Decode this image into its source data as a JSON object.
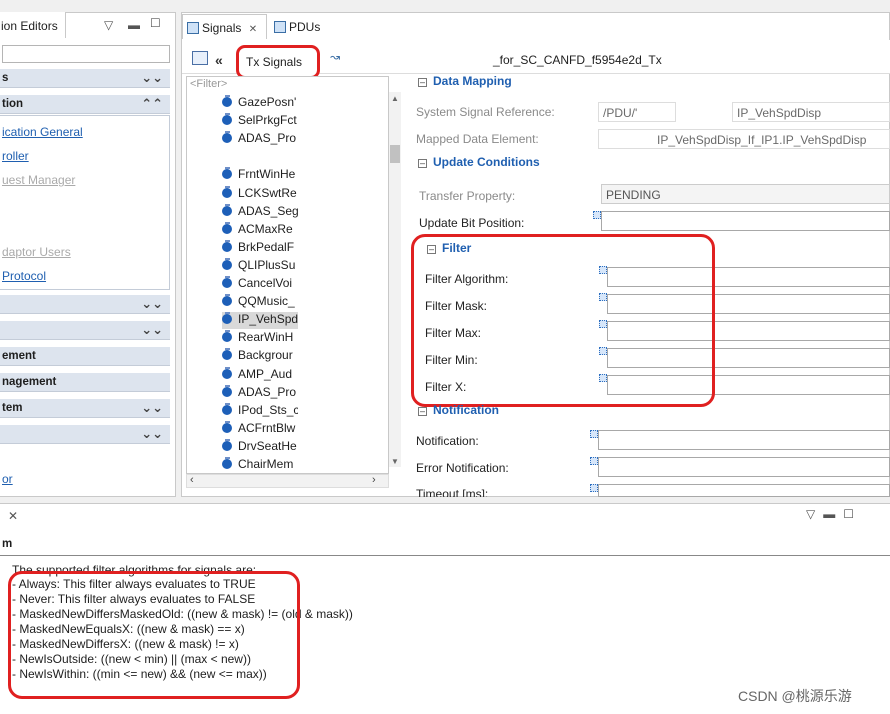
{
  "left": {
    "tab_label": "ion Editors",
    "sections": [
      {
        "label": "s",
        "state": "collapsed"
      },
      {
        "label": "tion",
        "state": "expanded"
      },
      {
        "label": "",
        "state": "collapsed"
      },
      {
        "label": "",
        "state": "collapsed"
      },
      {
        "label": "ement",
        "state": "none"
      },
      {
        "label": "nagement",
        "state": "none"
      },
      {
        "label": "tem",
        "state": "collapsed"
      },
      {
        "label": "",
        "state": "collapsed"
      }
    ],
    "links": [
      "ication General",
      "roller",
      "uest Manager",
      "daptor Users",
      " Protocol"
    ],
    "bottom_link": "or"
  },
  "tabs": [
    {
      "label": "Signals",
      "close": "✕"
    },
    {
      "label": "PDUs"
    }
  ],
  "toolbar": {
    "collapse_glyph": "«",
    "tx_signals_label": "Tx Signals",
    "title": "_for_SC_CANFD_f5954e2d_Tx"
  },
  "signal_list": {
    "filter_placeholder": "<Filter>",
    "items": [
      "GazePosn'",
      "SelPrkgFct",
      "ADAS_Pro",
      "",
      "FrntWinHe",
      "LCKSwtRe",
      "ADAS_Seg",
      "ACMaxRe",
      "BrkPedalF",
      "QLIPlusSu",
      "CancelVoi",
      "QQMusic_",
      "IP_VehSpd",
      "RearWinH",
      "Backgrour",
      "AMP_Aud",
      "ADAS_Pro",
      "IPod_Sts_c",
      "ACFrntBlw",
      "DrvSeatHe",
      "ChairMem"
    ],
    "selected_index": 12
  },
  "props": {
    "data_mapping": {
      "title": "Data Mapping",
      "system_signal_label": "System Signal Reference:",
      "system_signal_value_a": "/PDU/'",
      "system_signal_value_b": "IP_VehSpdDisp",
      "mapped_label": "Mapped Data Element:",
      "mapped_value": "IP_VehSpdDisp_If_IP1.IP_VehSpdDisp"
    },
    "update_conditions": {
      "title": "Update Conditions",
      "transfer_label": "Transfer Property:",
      "transfer_value": "PENDING",
      "update_bit_label": "Update Bit Position:"
    },
    "filter": {
      "title": "Filter",
      "fields": [
        "Filter Algorithm:",
        "Filter Mask:",
        "Filter Max:",
        "Filter Min:",
        "Filter X:"
      ]
    },
    "notification": {
      "title": "Notification",
      "fields": [
        "Notification:",
        "Error Notification:",
        "Timeout [ms]:"
      ]
    }
  },
  "help": {
    "close": "✕",
    "title": "m",
    "intro": "The supported filter algorithms for signals are:",
    "lines": [
      "- Always: This filter always evaluates to TRUE",
      "- Never: This filter always evaluates to FALSE",
      "- MaskedNewDiffersMaskedOld: ((new & mask) != (old & mask))",
      "- MaskedNewEqualsX:  ((new & mask) == x)",
      "- MaskedNewDiffersX:  ((new & mask) != x)",
      "- NewIsOutside: ((new < min) || (max < new))",
      "- NewIsWithin: ((min <= new) && (new <= max))"
    ]
  },
  "watermark": "CSDN @桃源乐游",
  "colors": {
    "annotation": "#e02020",
    "section_title": "#1f5fb0",
    "section_bar": "#dde4ee"
  }
}
